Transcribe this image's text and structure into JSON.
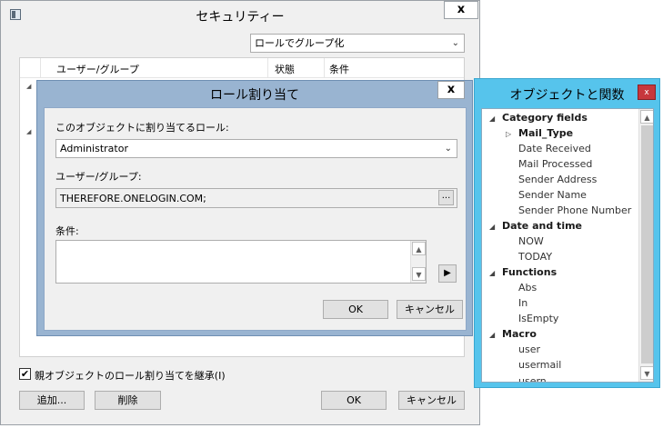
{
  "security": {
    "title": "セキュリティー",
    "close_label": "x",
    "group_combo": "ロールでグループ化",
    "columns": [
      "ユーザー/グループ",
      "状態",
      "条件"
    ],
    "inherit_label": "親オブジェクトのロール割り当てを継承(I)",
    "inherit_checked": true,
    "buttons": {
      "add": "追加...",
      "delete": "削除",
      "ok": "OK",
      "cancel": "キャンセル"
    }
  },
  "role_dialog": {
    "title": "ロール割り当て",
    "close_label": "x",
    "role_label": "このオブジェクトに割り当てるロール:",
    "role_value": "Administrator",
    "user_label": "ユーザー/グループ:",
    "user_value": "THEREFORE.ONELOGIN.COM;",
    "ellipsis": "...",
    "condition_label": "条件:",
    "condition_value": "",
    "buttons": {
      "ok": "OK",
      "cancel": "キャンセル"
    }
  },
  "objects_panel": {
    "title": "オブジェクトと関数",
    "close_label": "x",
    "tree": [
      {
        "label": "Category fields",
        "type": "category",
        "children": [
          {
            "label": "Mail_Type",
            "type": "subcategory"
          },
          {
            "label": "Date Received"
          },
          {
            "label": "Mail Processed"
          },
          {
            "label": "Sender Address"
          },
          {
            "label": "Sender Name"
          },
          {
            "label": "Sender Phone Number"
          }
        ]
      },
      {
        "label": "Date and time",
        "type": "category",
        "children": [
          {
            "label": "NOW"
          },
          {
            "label": "TODAY"
          }
        ]
      },
      {
        "label": "Functions",
        "type": "category",
        "children": [
          {
            "label": "Abs"
          },
          {
            "label": "In"
          },
          {
            "label": "IsEmpty"
          }
        ]
      },
      {
        "label": "Macro",
        "type": "category",
        "children": [
          {
            "label": "user"
          },
          {
            "label": "usermail"
          },
          {
            "label": "usern..."
          }
        ]
      }
    ]
  },
  "colors": {
    "accent_panel": "#56c4ec",
    "dialog_frame": "#99b4d1",
    "close_red": "#c7373c"
  }
}
